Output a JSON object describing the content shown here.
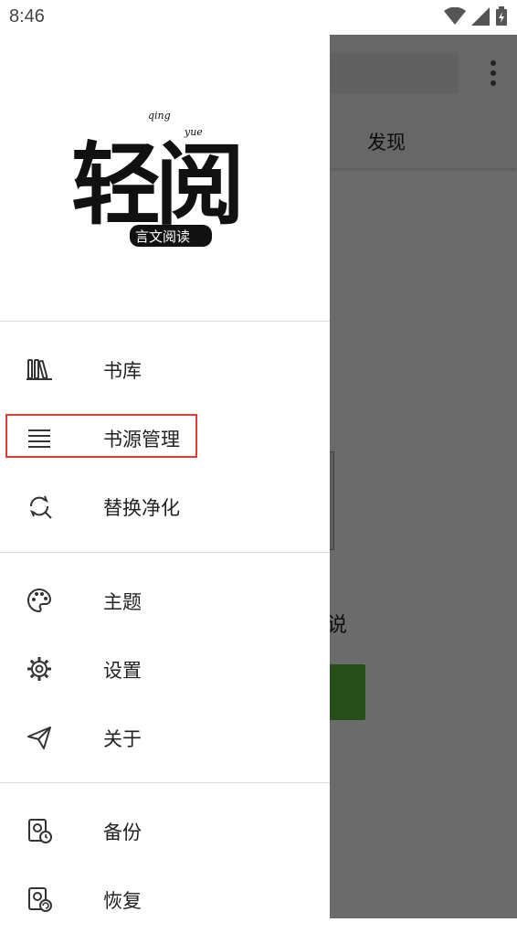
{
  "status_bar": {
    "time": "8:46"
  },
  "background_app": {
    "tab_label": "发现",
    "partial_text": "说",
    "accent_color": "#5cbb3b"
  },
  "drawer": {
    "logo_text": "轻阅",
    "logo_sub": "言文阅读",
    "logo_pinyin_1": "qing",
    "logo_pinyin_2": "yue",
    "sections": [
      {
        "items": [
          {
            "label": "书库",
            "icon": "library-icon"
          },
          {
            "label": "书源管理",
            "icon": "list-icon",
            "highlighted": true
          },
          {
            "label": "替换净化",
            "icon": "find-replace-icon"
          }
        ]
      },
      {
        "items": [
          {
            "label": "主题",
            "icon": "palette-icon"
          },
          {
            "label": "设置",
            "icon": "gear-icon"
          },
          {
            "label": "关于",
            "icon": "send-icon"
          }
        ]
      },
      {
        "items": [
          {
            "label": "备份",
            "icon": "backup-icon"
          },
          {
            "label": "恢复",
            "icon": "restore-icon"
          }
        ]
      }
    ]
  },
  "highlight_color": "#e53935"
}
